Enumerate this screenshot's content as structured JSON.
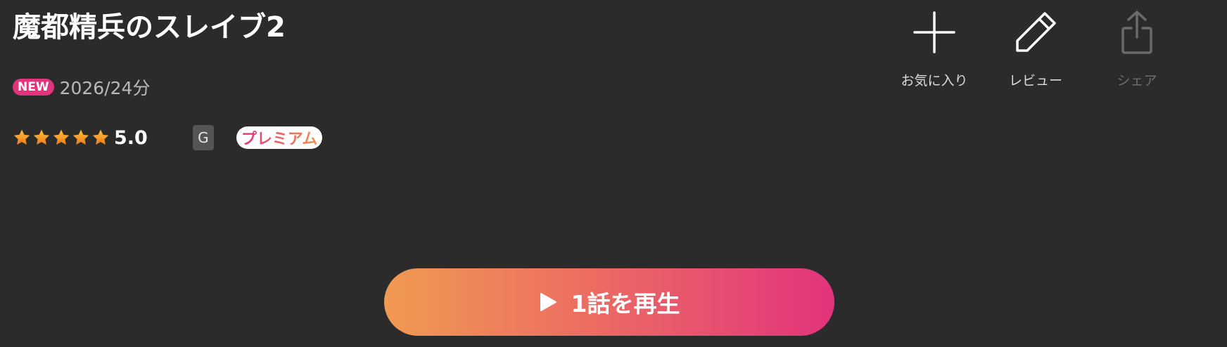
{
  "title": "魔都精兵のスレイブ2",
  "meta": {
    "new_badge": "NEW",
    "year_duration": "2026/24分"
  },
  "rating": {
    "stars": 5,
    "value": "5.0",
    "age_rating": "G",
    "premium_label": "プレミアム"
  },
  "actions": [
    {
      "label": "お気に入り",
      "icon": "plus-icon",
      "enabled": true
    },
    {
      "label": "レビュー",
      "icon": "pencil-icon",
      "enabled": true
    },
    {
      "label": "シェア",
      "icon": "share-icon",
      "enabled": false
    }
  ],
  "play_button": {
    "label": "1話を再生",
    "icon": "play-icon"
  },
  "colors": {
    "background": "#2b2b2b",
    "accent_pink": "#e2337d",
    "accent_orange": "#f09a52",
    "star": "#f5a623"
  }
}
